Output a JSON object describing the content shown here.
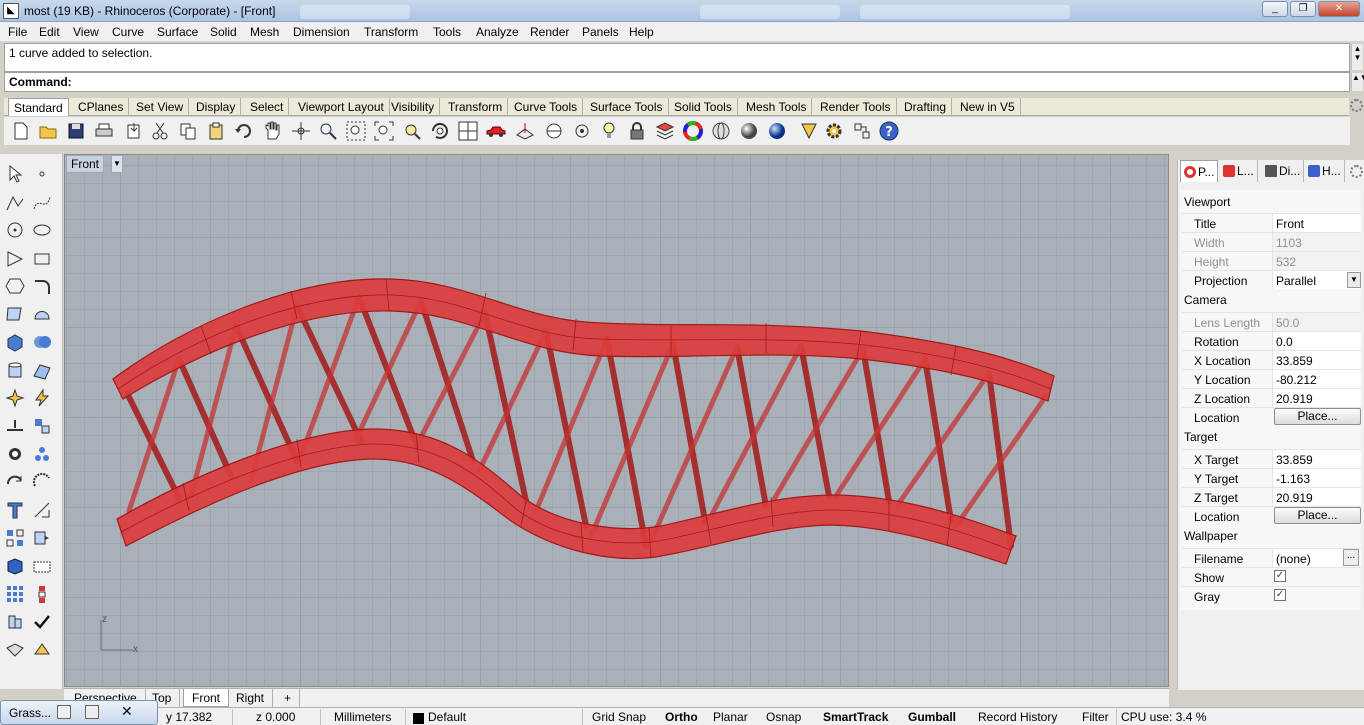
{
  "window": {
    "title": "most (19 KB) - Rhinoceros (Corporate) - [Front]",
    "controls": [
      "_",
      "❐",
      "✕"
    ]
  },
  "menu": [
    "File",
    "Edit",
    "View",
    "Curve",
    "Surface",
    "Solid",
    "Mesh",
    "Dimension",
    "Transform",
    "Tools",
    "Analyze",
    "Render",
    "Panels",
    "Help"
  ],
  "command": {
    "history": "1 curve added to selection.",
    "prompt": "Command:"
  },
  "tabs": [
    "Standard",
    "CPlanes",
    "Set View",
    "Display",
    "Select",
    "Viewport Layout",
    "Visibility",
    "Transform",
    "Curve Tools",
    "Surface Tools",
    "Solid Tools",
    "Mesh Tools",
    "Render Tools",
    "Drafting",
    "New in V5"
  ],
  "toolbar_icons": [
    "new-file-icon",
    "open-icon",
    "save-icon",
    "print-icon",
    "import-icon",
    "cut-icon",
    "copy-icon",
    "paste-icon",
    "undo-icon",
    "pan-icon",
    "move-view-icon",
    "zoom-icon",
    "zoom-window-icon",
    "zoom-extents-icon",
    "zoom-selected-icon",
    "rotate-view-icon",
    "four-viewports-icon",
    "car-icon",
    "cplane-icon",
    "snap-icon",
    "light-icon",
    "lock-icon",
    "layer-icon",
    "color-wheel-icon",
    "wireframe-sphere-icon",
    "shaded-sphere-icon",
    "render-sphere-icon",
    "osnap-icon",
    "options-gear-icon",
    "properties-icon",
    "help-icon"
  ],
  "viewport": {
    "name": "Front",
    "axis_z": "z",
    "axis_x": "x",
    "tabs": [
      "Perspective",
      "Top",
      "Front",
      "Right"
    ],
    "add_tab": "+"
  },
  "panel": {
    "tabs": [
      "P...",
      "L...",
      "Di...",
      "H..."
    ],
    "viewport_header": "Viewport",
    "title_label": "Title",
    "title_value": "Front",
    "width_label": "Width",
    "width_value": "1103",
    "height_label": "Height",
    "height_value": "532",
    "projection_label": "Projection",
    "projection_value": "Parallel",
    "camera_header": "Camera",
    "lens_label": "Lens Length",
    "lens_value": "50.0",
    "rotation_label": "Rotation",
    "rotation_value": "0.0",
    "xloc_label": "X Location",
    "xloc_value": "33.859",
    "yloc_label": "Y Location",
    "yloc_value": "-80.212",
    "zloc_label": "Z Location",
    "zloc_value": "20.919",
    "loc_label": "Location",
    "place_label": "Place...",
    "target_header": "Target",
    "xt_label": "X Target",
    "xt_value": "33.859",
    "yt_label": "Y Target",
    "yt_value": "-1.163",
    "zt_label": "Z Target",
    "zt_value": "20.919",
    "tloc_label": "Location",
    "tplace_label": "Place...",
    "wallpaper_header": "Wallpaper",
    "filename_label": "Filename",
    "filename_value": "(none)",
    "browse_label": "...",
    "show_label": "Show",
    "show_checked": true,
    "gray_label": "Gray",
    "gray_checked": true
  },
  "status": {
    "task_label": "Grass...",
    "y": "y 17.382",
    "z": "z 0.000",
    "units": "Millimeters",
    "layer": "Default",
    "grid_snap": "Grid Snap",
    "ortho": "Ortho",
    "planar": "Planar",
    "osnap": "Osnap",
    "smarttrack": "SmartTrack",
    "gumball": "Gumball",
    "record_history": "Record History",
    "filter": "Filter",
    "cpu": "CPU use: 3.4 %"
  },
  "colors": {
    "bridge_fill": "#dc3c3c",
    "bridge_edge": "#a01a1a",
    "viewport_bg": "#a9b0b8"
  }
}
